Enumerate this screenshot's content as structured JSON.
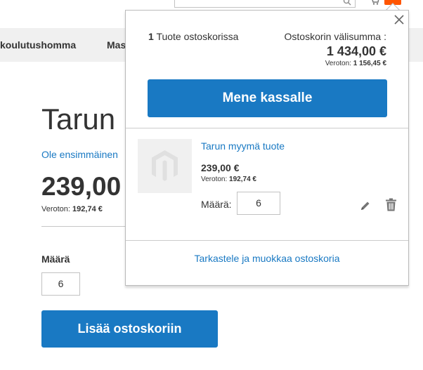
{
  "nav": {
    "items": [
      "koulutushomma",
      "Mas"
    ]
  },
  "product": {
    "title": "Tarun m",
    "review_link": "Ole ensimmäinen",
    "price": "239,00",
    "excl_label": "Veroton:",
    "excl_value": "192,74 €",
    "qty_label": "Määrä",
    "qty_value": "6",
    "add_to_cart_label": "Lisää ostoskoriin"
  },
  "minicart": {
    "items_count_number": "1",
    "items_count_text": "Tuote ostoskorissa",
    "subtotal_label": "Ostoskorin välisumma :",
    "subtotal_amount": "1 434,00 €",
    "subtotal_excl_label": "Veroton:",
    "subtotal_excl_value": "1 156,45 €",
    "checkout_label": "Mene kassalle",
    "item": {
      "name": "Tarun myymä tuote",
      "price": "239,00 €",
      "excl_label": "Veroton:",
      "excl_value": "192,74 €",
      "qty_label": "Määrä:",
      "qty_value": "6"
    },
    "view_cart_label": "Tarkastele ja muokkaa ostoskoria"
  },
  "colors": {
    "accent": "#1979c3",
    "badge": "#ff5501",
    "nav_bg": "#f0f0f0"
  },
  "icons": {
    "close": "close-icon",
    "edit": "pencil-icon",
    "delete": "trash-icon",
    "search": "search-icon",
    "cart": "cart-icon",
    "placeholder": "magento-logo-icon"
  }
}
